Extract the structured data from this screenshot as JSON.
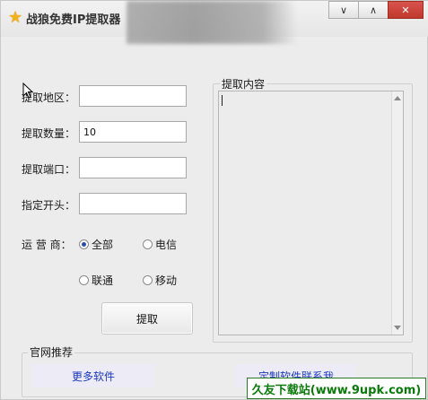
{
  "window": {
    "title": "战狼免费IP提取器",
    "controls": {
      "minimize": "∨",
      "maximize": "∧",
      "close": "✕"
    }
  },
  "form": {
    "region": {
      "label": "提取地区：",
      "value": ""
    },
    "count": {
      "label": "提取数量：",
      "value": "10"
    },
    "port": {
      "label": "提取端口：",
      "value": ""
    },
    "prefix": {
      "label": "指定开头：",
      "value": ""
    },
    "carrier": {
      "label": "运 营 商：",
      "options": [
        {
          "label": "全部",
          "selected": true
        },
        {
          "label": "电信",
          "selected": false
        },
        {
          "label": "联通",
          "selected": false
        },
        {
          "label": "移动",
          "selected": false
        }
      ]
    },
    "fetch_button": "提取"
  },
  "content": {
    "title": "提取内容",
    "text": ""
  },
  "official": {
    "title": "官网推荐",
    "more_software": "更多软件",
    "custom_software": "定制软件联系我"
  },
  "watermark": "久友下载站(www.9upk.com)",
  "colors": {
    "accent": "#1a37c4",
    "radio_dot": "#2b4ea8",
    "watermark": "#0a7a0a"
  }
}
